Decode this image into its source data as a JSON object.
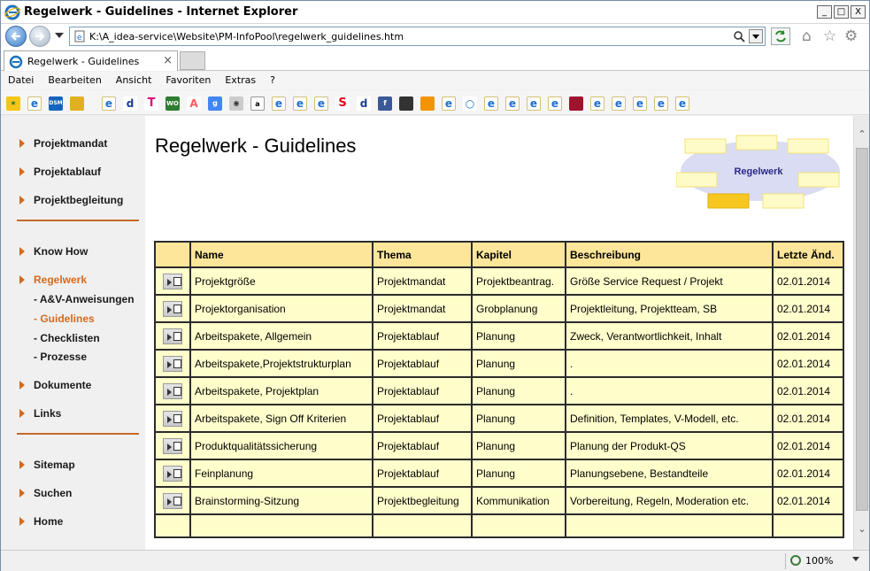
{
  "window": {
    "title": "Regelwerk - Guidelines - Internet Explorer",
    "minimize": "_",
    "maximize": "□",
    "close": "X"
  },
  "address": {
    "url": "K:\\A_idea-service\\Website\\PM-InfoPool\\regelwerk_guidelines.htm"
  },
  "tab": {
    "label": "Regelwerk - Guidelines",
    "close": "×"
  },
  "menu": [
    "Datei",
    "Bearbeiten",
    "Ansicht",
    "Favoriten",
    "Extras",
    "?"
  ],
  "icons": {
    "home": "⌂",
    "star": "☆",
    "gear": "⚙"
  },
  "sidebar": {
    "group1": [
      "Projektmandat",
      "Projektablauf",
      "Projektbegleitung"
    ],
    "group2": [
      "Know How",
      "Regelwerk"
    ],
    "sub": [
      "- A&V-Anweisungen",
      "- Guidelines",
      "- Checklisten",
      "- Prozesse"
    ],
    "group3": [
      "Dokumente",
      "Links"
    ],
    "group4": [
      "Sitemap",
      "Suchen",
      "Home"
    ]
  },
  "main": {
    "title": "Regelwerk - Guidelines",
    "logo_label": "Regelwerk"
  },
  "table": {
    "headers": [
      "",
      "Name",
      "Thema",
      "Kapitel",
      "Beschreibung",
      "Letzte Änd."
    ],
    "rows": [
      [
        "Projektgröße",
        "Projektmandat",
        "Projektbeantrag.",
        "Größe Service Request / Projekt",
        "02.01.2014"
      ],
      [
        "Projektorganisation",
        "Projektmandat",
        "Grobplanung",
        "Projektleitung, Projektteam, SB",
        "02.01.2014"
      ],
      [
        "Arbeitspakete, Allgemein",
        "Projektablauf",
        "Planung",
        "Zweck, Verantwortlichkeit, Inhalt",
        "02.01.2014"
      ],
      [
        "Arbeitspakete,Projektstrukturplan",
        "Projektablauf",
        "Planung",
        ".",
        "02.01.2014"
      ],
      [
        "Arbeitspakete, Projektplan",
        "Projektablauf",
        "Planung",
        ".",
        "02.01.2014"
      ],
      [
        "Arbeitspakete, Sign Off Kriterien",
        "Projektablauf",
        "Planung",
        "Definition, Templates, V-Modell, etc.",
        "02.01.2014"
      ],
      [
        "Produktqualitätssicherung",
        "Projektablauf",
        "Planung",
        "Planung der Produkt-QS",
        "02.01.2014"
      ],
      [
        "Feinplanung",
        "Projektablauf",
        "Planung",
        "Planungsebene, Bestandteile",
        "02.01.2014"
      ],
      [
        "Brainstorming-Sitzung",
        "Projektbegleitung",
        "Kommunikation",
        "Vorbereitung, Regeln, Moderation etc.",
        "02.01.2014"
      ]
    ]
  },
  "status": {
    "zoom": "100%"
  },
  "scroll": {
    "up": "⌃",
    "down": "⌄"
  }
}
